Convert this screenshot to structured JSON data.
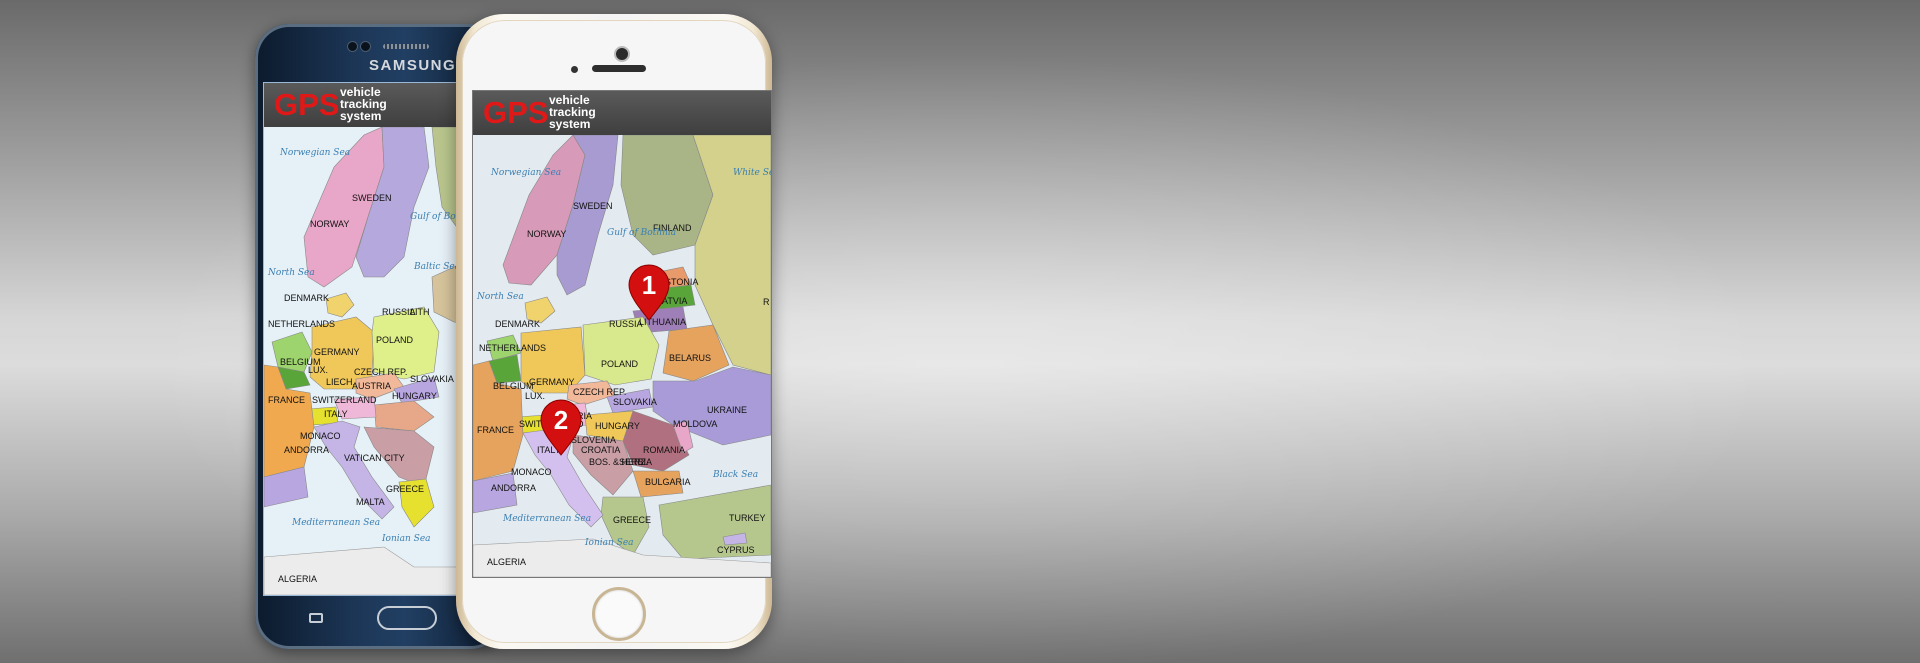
{
  "samsung_phone": {
    "brand": "SAMSUNG",
    "app": {
      "logo": "GPS",
      "tagline": [
        "vehicle",
        "tracking",
        "system"
      ]
    },
    "map_labels": {
      "countries": [
        "SWEDEN",
        "NORWAY",
        "DENMARK",
        "NETHERLANDS",
        "GERMANY",
        "POLAND",
        "BELGIUM",
        "LUX.",
        "CZECH REP.",
        "AUSTRIA",
        "SLOVAKIA",
        "LIECH.",
        "SWITZERLAND",
        "HUNGARY",
        "FRANCE",
        "ITALY",
        "MONACO",
        "ANDORRA",
        "MALTA",
        "GREECE",
        "VATICAN CITY",
        "RUSSIA",
        "LITH",
        "ALGERIA"
      ],
      "seas": [
        "Norwegian Sea",
        "Gulf of Bothnia",
        "North Sea",
        "Baltic Sea",
        "Mediterranean Sea",
        "Ionian Sea"
      ]
    }
  },
  "iphone": {
    "app": {
      "logo": "GPS",
      "tagline": [
        "vehicle",
        "tracking",
        "system"
      ]
    },
    "map_labels": {
      "countries": [
        "SWEDEN",
        "NORWAY",
        "FINLAND",
        "DENMARK",
        "ESTONIA",
        "LATVIA",
        "LITHUANIA",
        "RUSSIA",
        "BELARUS",
        "NETHERLANDS",
        "GERMANY",
        "POLAND",
        "BELGIUM",
        "LUX.",
        "CZECH REP.",
        "SLOVAKIA",
        "AUSTRIA",
        "SWITZERLAND",
        "HUNGARY",
        "UKRAINE",
        "MOLDOVA",
        "ROMANIA",
        "FRANCE",
        "ITALY",
        "SLOVENIA",
        "CROATIA",
        "BOS. & HERZ.",
        "SERBIA",
        "BULGARIA",
        "MONACO",
        "ANDORRA",
        "GREECE",
        "TURKEY",
        "CYPRUS",
        "ALGERIA",
        "R"
      ],
      "seas": [
        "Norwegian Sea",
        "Gulf of Bothnia",
        "White Sea",
        "North Sea",
        "Black Sea",
        "Mediterranean Sea",
        "Ionian Sea"
      ]
    },
    "markers": [
      "1",
      "2"
    ]
  },
  "colors": {
    "gps_red": "#e01818",
    "marker_red": "#d30f0f",
    "header_gray": "#4a4a4a",
    "sea": "#e3ebf0"
  }
}
